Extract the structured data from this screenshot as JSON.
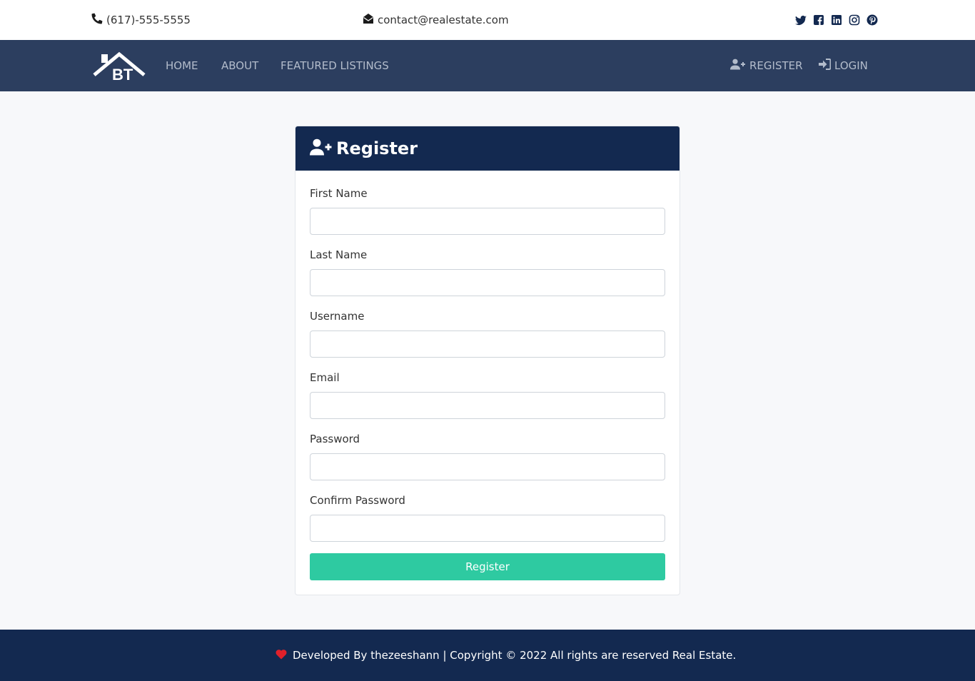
{
  "contact": {
    "phone": "(617)-555-5555",
    "email": "contact@realestate.com",
    "phone_icon": "phone-icon",
    "email_icon": "envelope-open-icon"
  },
  "social": [
    "twitter-icon",
    "facebook-icon",
    "linkedin-icon",
    "instagram-icon",
    "pinterest-icon"
  ],
  "nav": {
    "logo_text": "BT",
    "home": "HOME",
    "about": "ABOUT",
    "featured": "FEATURED LISTINGS",
    "register": "REGISTER",
    "login": "LOGIN"
  },
  "form": {
    "title": "Register",
    "fields": [
      {
        "label": "First Name",
        "value": ""
      },
      {
        "label": "Last Name",
        "value": ""
      },
      {
        "label": "Username",
        "value": ""
      },
      {
        "label": "Email",
        "value": ""
      },
      {
        "label": "Password",
        "value": ""
      },
      {
        "label": "Confirm Password",
        "value": ""
      }
    ],
    "submit_label": "Register"
  },
  "footer": {
    "text": "Developed By thezeeshann | Copyright © 2022 All rights are reserved Real Estate."
  },
  "colors": {
    "nav_bg": "#2c3e5f",
    "header_bg": "#132950",
    "footer_bg": "#132950",
    "button_bg": "#2ecaa1",
    "heart": "#e0202a"
  }
}
